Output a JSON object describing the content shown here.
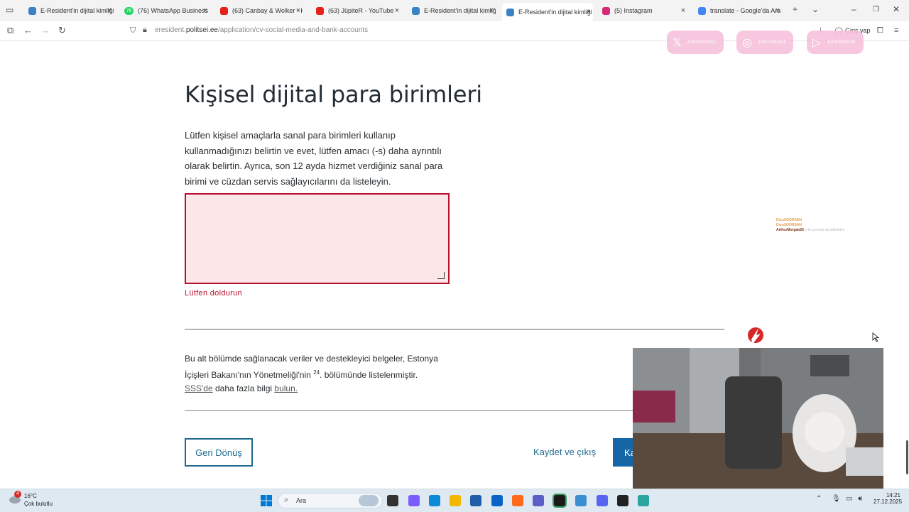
{
  "tabs": [
    {
      "title": "E-Resident'in dijital kimliği",
      "icon": "shield-icon",
      "color": "#3b82c4"
    },
    {
      "title": "(76) WhatsApp Business",
      "icon": "whatsapp-icon",
      "color": "#25d366",
      "badge": "76"
    },
    {
      "title": "(63) Canbay & Wolker - Ka",
      "icon": "youtube-icon",
      "color": "#e62117"
    },
    {
      "title": "(63) JüpiteR - YouTube",
      "icon": "youtube-icon",
      "color": "#e62117"
    },
    {
      "title": "E-Resident'in dijital kimliği",
      "icon": "shield-icon",
      "color": "#3b82c4"
    },
    {
      "title": "E-Resident'in dijital kimliği",
      "icon": "shield-icon",
      "color": "#3b82c4",
      "active": true
    },
    {
      "title": "(5) Instagram",
      "icon": "instagram-icon",
      "color": "#d62976"
    },
    {
      "title": "translate - Google'da Ara",
      "icon": "google-icon",
      "color": "#4285f4"
    }
  ],
  "address": {
    "prefix": "eresident.",
    "domain": "politsei.ee",
    "path": "/application/cv-social-media-and-bank-accounts"
  },
  "toolbar": {
    "login_label": "Giriş yap"
  },
  "page": {
    "title": "Kişisel dijital para birimleri",
    "description": "Lütfen kişisel amaçlarla sanal para birimleri kullanıp kullanmadığınızı belirtin ve evet, lütfen amacı (-s) daha ayrıntılı olarak belirtin. Ayrıca, son 12 ayda hizmet verdiğiniz sanal para birimi ve cüzdan servis sağlayıcılarını da listeleyin.",
    "textarea_value": "",
    "error": "Lütfen doldurun",
    "info_part1": "Bu alt bölümde sağlanacak veriler ve destekleyici belgeler, Estonya İçişleri Bakanı'nın Yönetmeliği'nin",
    "info_sup": "24",
    "info_part2": ". bölümünde listelenmiştir.",
    "info_link1": "SSS'de",
    "info_part3": " daha fazla bilgi",
    "info_link2": "bulun."
  },
  "buttons": {
    "back": "Geri Dönüş",
    "save": "Kaydet ve çıkış",
    "next": "Ka"
  },
  "overlay": {
    "socials": [
      {
        "icon": "x-logo-icon",
        "handle": "JUPITERI2022"
      },
      {
        "icon": "instagram-icon",
        "handle": "JUPITERI2025"
      },
      {
        "icon": "youtube-icon",
        "handle": "JUPITERI2025"
      }
    ],
    "chat": [
      {
        "user": "DoruSOORSAN",
        "text": ""
      },
      {
        "user": "DoruSOORSAN",
        "text": ""
      },
      {
        "user": "ArthurMorgan26",
        "text": "o bu yorsaki da lukimidim"
      }
    ]
  },
  "taskbar": {
    "weather_temp": "16°C",
    "weather_desc": "Çok bulutlu",
    "weather_badge": "4",
    "search_label": "Ara",
    "time": "14:21",
    "date": "27.12.2025"
  }
}
